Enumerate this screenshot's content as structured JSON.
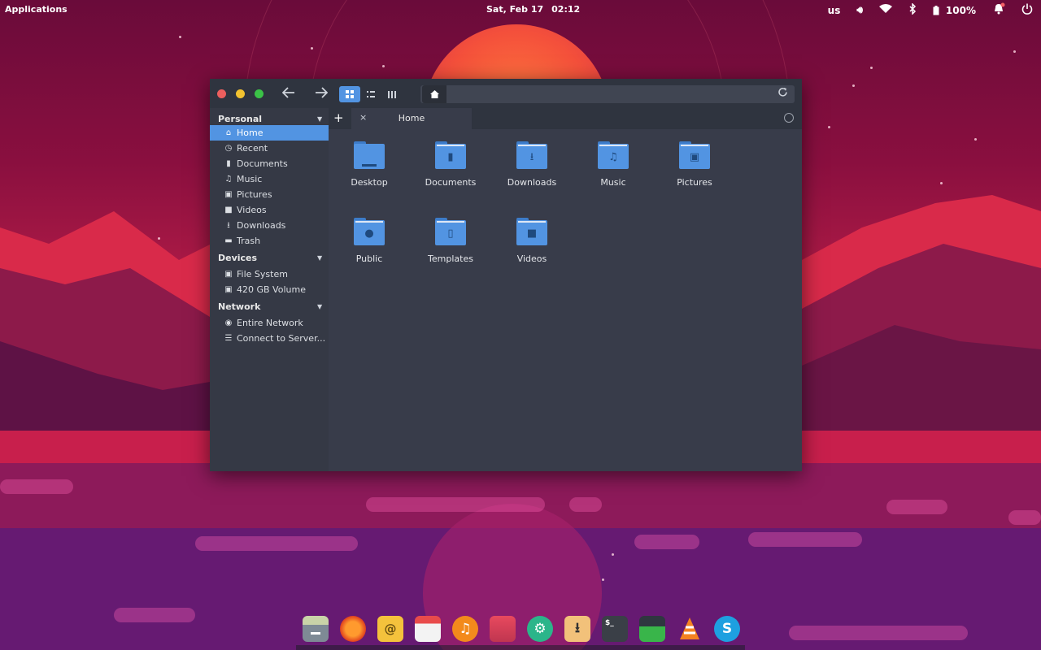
{
  "topbar": {
    "applications_label": "Applications",
    "date": "Sat, Feb 17",
    "time": "02:12",
    "keyboard_layout": "us",
    "battery": "100%",
    "icons": [
      "volume-icon",
      "wifi-icon",
      "bluetooth-icon",
      "battery-icon",
      "notification-bell-icon",
      "power-icon"
    ]
  },
  "window": {
    "path_home_icon": "home-icon",
    "tab": {
      "label": "Home",
      "close": "×"
    },
    "add_tab": "+"
  },
  "sidebar": {
    "sections": [
      {
        "title": "Personal",
        "items": [
          {
            "label": "Home",
            "icon": "home-icon",
            "active": true
          },
          {
            "label": "Recent",
            "icon": "clock-icon"
          },
          {
            "label": "Documents",
            "icon": "document-icon"
          },
          {
            "label": "Music",
            "icon": "music-icon"
          },
          {
            "label": "Pictures",
            "icon": "picture-icon"
          },
          {
            "label": "Videos",
            "icon": "video-icon"
          },
          {
            "label": "Downloads",
            "icon": "download-icon"
          },
          {
            "label": "Trash",
            "icon": "trash-icon"
          }
        ]
      },
      {
        "title": "Devices",
        "items": [
          {
            "label": "File System",
            "icon": "drive-icon"
          },
          {
            "label": "420 GB Volume",
            "icon": "drive-icon"
          }
        ]
      },
      {
        "title": "Network",
        "items": [
          {
            "label": "Entire Network",
            "icon": "globe-icon"
          },
          {
            "label": "Connect to Server...",
            "icon": "server-icon"
          }
        ]
      }
    ]
  },
  "files": [
    {
      "name": "Desktop",
      "icon": "desktop-folder-icon"
    },
    {
      "name": "Documents",
      "icon": "documents-folder-icon"
    },
    {
      "name": "Downloads",
      "icon": "downloads-folder-icon"
    },
    {
      "name": "Music",
      "icon": "music-folder-icon"
    },
    {
      "name": "Pictures",
      "icon": "pictures-folder-icon"
    },
    {
      "name": "Public",
      "icon": "public-folder-icon"
    },
    {
      "name": "Templates",
      "icon": "templates-folder-icon"
    },
    {
      "name": "Videos",
      "icon": "videos-folder-icon"
    }
  ],
  "dock": {
    "apps": [
      "files-app-icon",
      "firefox-icon",
      "mail-icon",
      "calendar-icon",
      "music-player-icon",
      "photos-icon",
      "settings-icon",
      "downloader-icon",
      "terminal-icon",
      "system-monitor-icon",
      "vlc-icon",
      "skype-icon"
    ],
    "terminal_prompt": "$_"
  },
  "colors": {
    "accent": "#5294e2",
    "close": "#ec5f5e",
    "minimize": "#f2c230",
    "maximize": "#3bc247"
  }
}
